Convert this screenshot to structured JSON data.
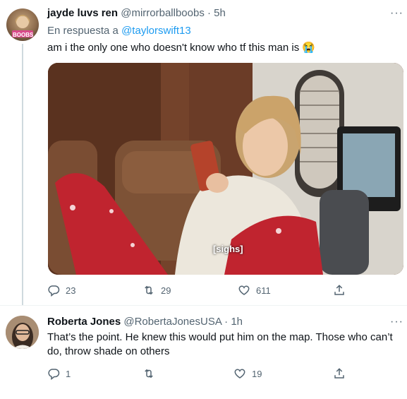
{
  "tweet1": {
    "author_name": "jayde luvs ren",
    "handle_time": "@mirrorballboobs · 5h",
    "reply_prefix": "En respuesta a",
    "reply_handle": "@taylorswift13",
    "text": "am i the only one who doesn't know who tf this man is 😭",
    "avatar_text": "BOOBS",
    "media_caption": "[sighs]",
    "replies": "23",
    "retweets": "29",
    "likes": "611"
  },
  "tweet2": {
    "author_name": "Roberta Jones",
    "handle_time": "@RobertaJonesUSA · 1h",
    "text_line1": "That’s the point. He knew this would put him on the map. Those who can’t",
    "text_line2": "do, throw shade on others",
    "replies": "1",
    "retweets": "",
    "likes": "19"
  },
  "colors": {
    "accent": "#1d9bf0",
    "muted": "#536471",
    "text": "#0f1419"
  },
  "icons": [
    "reply-icon",
    "retweet-icon",
    "like-icon",
    "share-icon",
    "more-icon"
  ]
}
